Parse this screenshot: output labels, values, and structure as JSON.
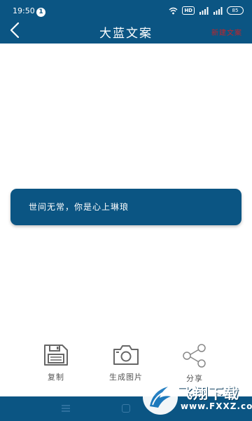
{
  "status_bar": {
    "time": "19:50",
    "notification_count": "1",
    "network_badge": "HD",
    "battery_level": "85"
  },
  "header": {
    "title": "大蓝文案",
    "action_label": "新建文案"
  },
  "quote": {
    "text": "世间无常，你是心上琳琅"
  },
  "actions": {
    "copy_label": "复制",
    "generate_image_label": "生成图片",
    "share_label": "分享"
  },
  "watermark": {
    "title": "飞翔下载",
    "url": "www.FXXZ.com"
  },
  "colors": {
    "primary": "#0b5583",
    "accent_red": "#c0242a",
    "icon_gray": "#666666"
  }
}
